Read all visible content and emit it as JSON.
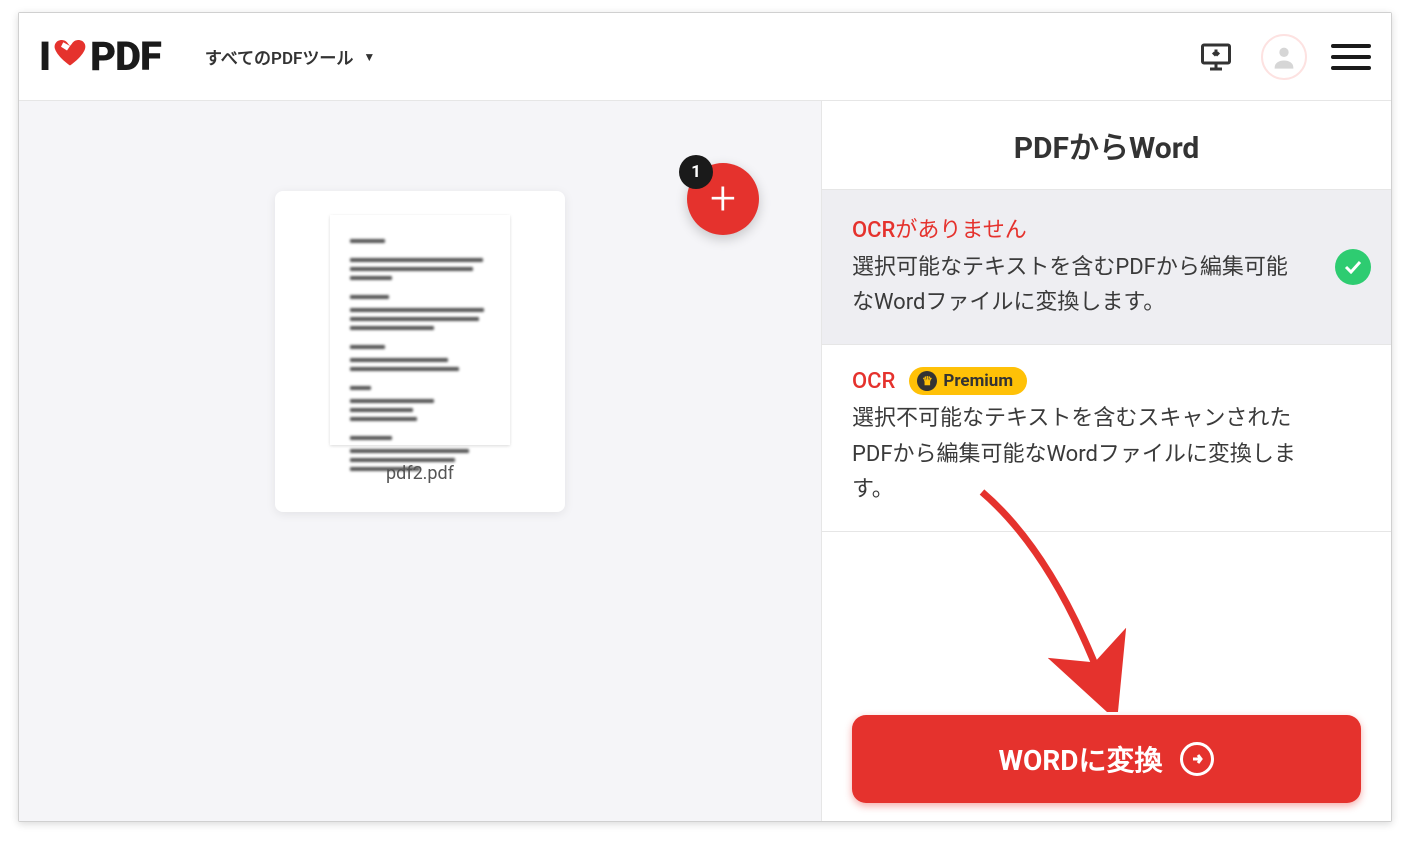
{
  "logo": {
    "prefix": "I",
    "suffix": "PDF"
  },
  "header": {
    "tools_label": "すべてのPDFツール"
  },
  "workspace": {
    "file_name": "pdf2.pdf",
    "add_badge_count": "1"
  },
  "panel": {
    "title": "PDFからWord",
    "options": [
      {
        "title": "OCRがありません",
        "desc": "選択可能なテキストを含むPDFから編集可能なWordファイルに変換します。",
        "selected": true
      },
      {
        "title": "OCR",
        "premium_label": "Premium",
        "desc": "選択不可能なテキストを含むスキャンされたPDFから編集可能なWordファイルに変換します。",
        "selected": false
      }
    ],
    "convert_label": "WORDに変換"
  }
}
